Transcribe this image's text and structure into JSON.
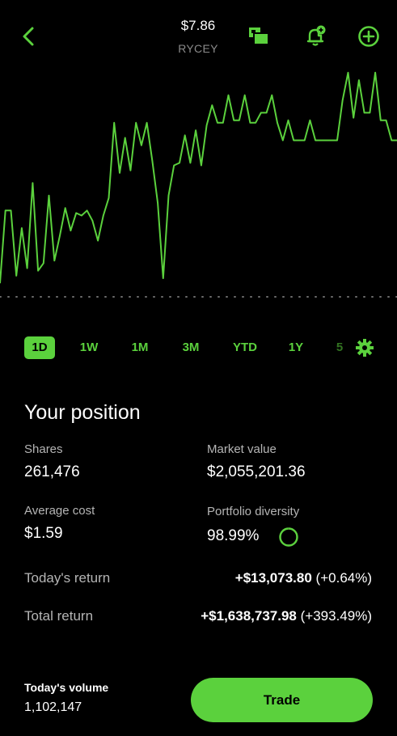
{
  "header": {
    "price": "$7.86",
    "ticker": "RYCEY",
    "icons": [
      "back-chevron-icon",
      "compare-icon",
      "add-alert-icon",
      "add-to-list-icon"
    ]
  },
  "colors": {
    "accent": "#5bd13d",
    "background": "#000000",
    "muted": "#8a8a8a"
  },
  "ranges": {
    "items": [
      "1D",
      "1W",
      "1M",
      "3M",
      "YTD",
      "1Y",
      "5"
    ],
    "selected": "1D"
  },
  "chart_data": {
    "type": "line",
    "series_color": "#5bd13d",
    "baseline_style": "dotted",
    "values": [
      0.8,
      3.7,
      3.7,
      1.1,
      3.0,
      1.4,
      4.8,
      1.3,
      1.6,
      4.3,
      1.7,
      2.7,
      3.8,
      2.9,
      3.6,
      3.5,
      3.7,
      3.3,
      2.5,
      3.5,
      4.2,
      7.2,
      5.2,
      6.6,
      5.3,
      7.2,
      6.3,
      7.2,
      5.7,
      4.0,
      1.0,
      4.3,
      5.5,
      5.6,
      6.7,
      5.6,
      6.9,
      5.5,
      7.1,
      7.9,
      7.2,
      7.2,
      8.3,
      7.3,
      7.3,
      8.3,
      7.2,
      7.2,
      7.6,
      7.6,
      8.3,
      7.2,
      6.5,
      7.3,
      6.5,
      6.5,
      6.5,
      7.3,
      6.5,
      6.5,
      6.5,
      6.5,
      6.5,
      8.1,
      9.2,
      7.4,
      8.9,
      7.6,
      7.6,
      9.2,
      7.3,
      7.3,
      6.5,
      6.5
    ],
    "ylim": [
      0,
      10
    ]
  },
  "position": {
    "title": "Your position",
    "shares_label": "Shares",
    "shares_value": "261,476",
    "market_value_label": "Market value",
    "market_value_value": "$2,055,201.36",
    "avg_cost_label": "Average cost",
    "avg_cost_value": "$1.59",
    "diversity_label": "Portfolio diversity",
    "diversity_value": "98.99%",
    "diversity_fraction": 0.9899,
    "todays_return_label": "Today's return",
    "todays_return_amount": "+$13,073.80",
    "todays_return_pct": "(+0.64%)",
    "total_return_label": "Total return",
    "total_return_amount": "+$1,638,737.98",
    "total_return_pct": "(+393.49%)"
  },
  "footer": {
    "volume_label": "Today's volume",
    "volume_value": "1,102,147",
    "trade_label": "Trade"
  }
}
